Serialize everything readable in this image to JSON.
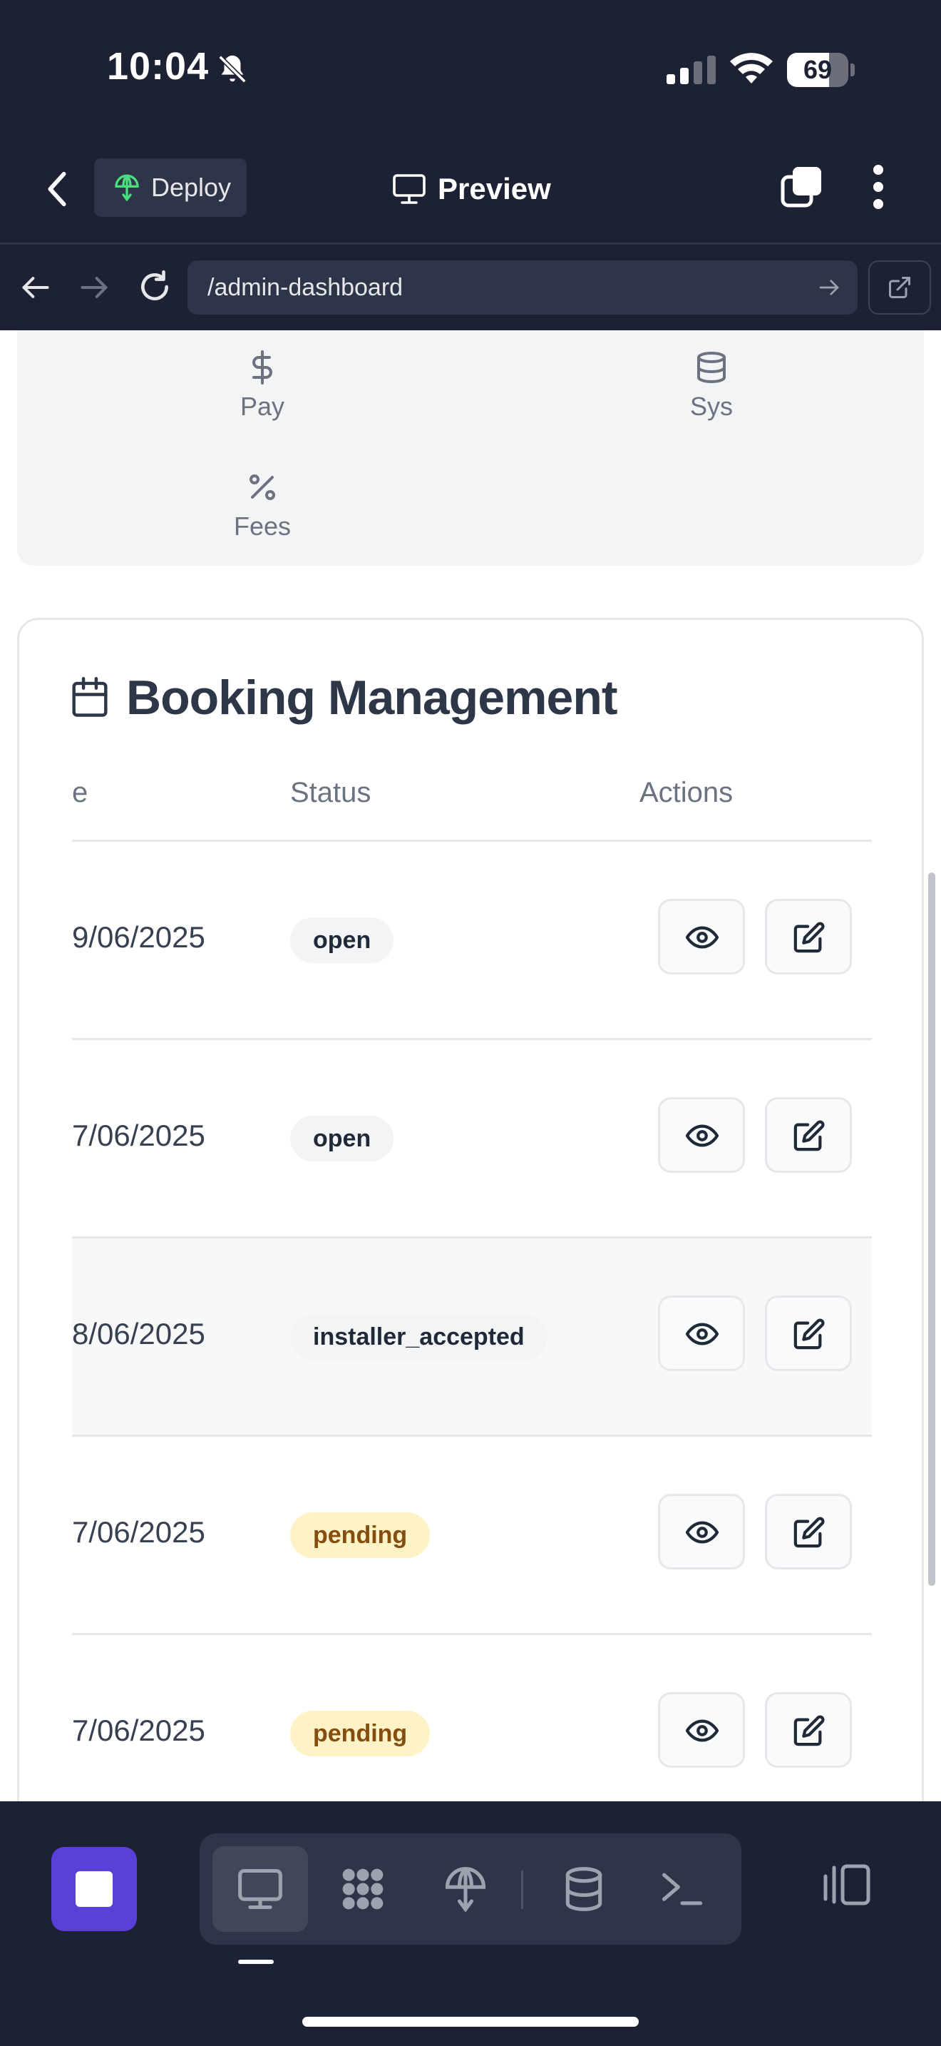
{
  "status_bar": {
    "time": "10:04",
    "battery": "69",
    "battery_level": 0.69
  },
  "app_bar": {
    "deploy_label": "Deploy",
    "title": "Preview"
  },
  "browser": {
    "url": "/admin-dashboard"
  },
  "admin_nav": {
    "items": [
      {
        "label": "Pay",
        "icon": "dollar-icon"
      },
      {
        "label": "Sys",
        "icon": "database-icon"
      },
      {
        "label": "Fees",
        "icon": "percent-icon"
      }
    ]
  },
  "booking": {
    "title": "Booking Management",
    "columns": {
      "date_partial": "e",
      "status": "Status",
      "actions": "Actions"
    },
    "rows": [
      {
        "date": "9/06/2025",
        "status": "open"
      },
      {
        "date": "7/06/2025",
        "status": "open"
      },
      {
        "date": "8/06/2025",
        "status": "installer_accepted"
      },
      {
        "date": "7/06/2025",
        "status": "pending"
      },
      {
        "date": "7/06/2025",
        "status": "pending"
      }
    ]
  },
  "bottom_bar": {
    "tools": [
      "desktop-icon",
      "workflow-icon",
      "deploy-icon",
      "database-icon",
      "terminal-icon"
    ]
  },
  "colors": {
    "background": "#1c2233",
    "accent": "#5b3fd9",
    "badge_open": "#f3f4f6",
    "badge_pending": "#fef3c7"
  }
}
